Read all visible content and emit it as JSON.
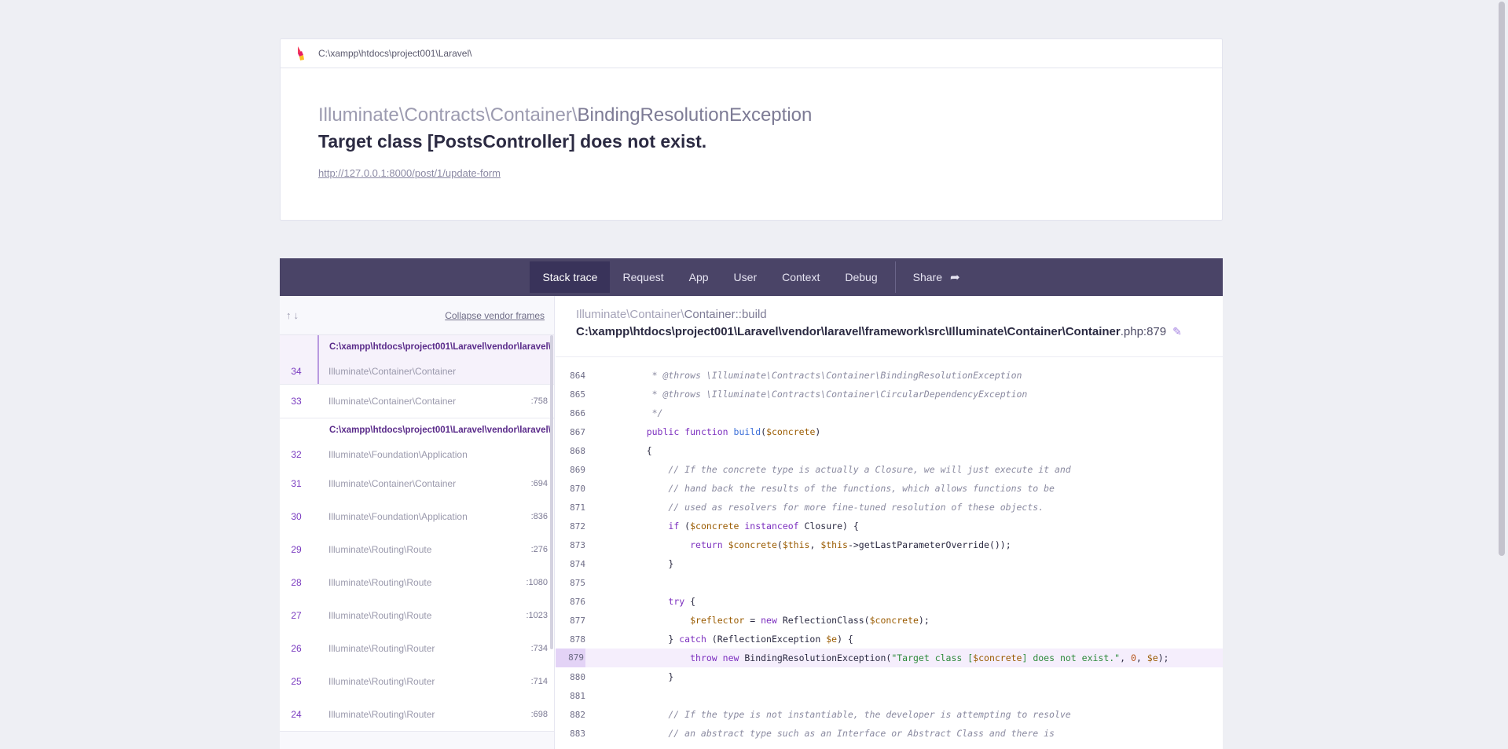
{
  "header": {
    "path": "C:\\xampp\\htdocs\\project001\\Laravel\\",
    "exception_namespace": "Illuminate\\Contracts\\Container\\",
    "exception_short": "BindingResolutionException",
    "message": "Target class [PostsController] does not exist.",
    "url": "http://127.0.0.1:8000/post/1/update-form"
  },
  "tabs": {
    "stack_trace": "Stack trace",
    "request": "Request",
    "app": "App",
    "user": "User",
    "context": "Context",
    "debug": "Debug",
    "share": "Share"
  },
  "frames": {
    "collapse_label": "Collapse vendor frames",
    "group1_file": "C:\\xampp\\htdocs\\project001\\Laravel\\vendor\\laravel\\",
    "group2_file": "C:\\xampp\\htdocs\\project001\\Laravel\\vendor\\laravel\\",
    "rows": [
      {
        "num": "34",
        "cls": "Illuminate\\Container\\Container",
        "line": ""
      },
      {
        "num": "33",
        "cls": "Illuminate\\Container\\Container",
        "line": ":758"
      },
      {
        "num": "32",
        "cls": "Illuminate\\Foundation\\Application",
        "line": ""
      },
      {
        "num": "31",
        "cls": "Illuminate\\Container\\Container",
        "line": ":694"
      },
      {
        "num": "30",
        "cls": "Illuminate\\Foundation\\Application",
        "line": ":836"
      },
      {
        "num": "29",
        "cls": "Illuminate\\Routing\\Route",
        "line": ":276"
      },
      {
        "num": "28",
        "cls": "Illuminate\\Routing\\Route",
        "line": ":1080"
      },
      {
        "num": "27",
        "cls": "Illuminate\\Routing\\Route",
        "line": ":1023"
      },
      {
        "num": "26",
        "cls": "Illuminate\\Routing\\Router",
        "line": ":734"
      },
      {
        "num": "25",
        "cls": "Illuminate\\Routing\\Router",
        "line": ":714"
      },
      {
        "num": "24",
        "cls": "Illuminate\\Routing\\Router",
        "line": ":698"
      }
    ]
  },
  "code": {
    "class_ns": "Illuminate\\Container\\",
    "class_method": "Container::build",
    "file": "C:\\xampp\\htdocs\\project001\\Laravel\\vendor\\laravel\\framework\\src\\Illuminate\\Container\\Container",
    "file_ext": ".php:879",
    "highlight_line": "879",
    "lines": [
      {
        "n": "864",
        "t": "     * @throws \\Illuminate\\Contracts\\Container\\BindingResolutionException"
      },
      {
        "n": "865",
        "t": "     * @throws \\Illuminate\\Contracts\\Container\\CircularDependencyException"
      },
      {
        "n": "866",
        "t": "     */"
      },
      {
        "n": "867",
        "t": "    public function build($concrete)"
      },
      {
        "n": "868",
        "t": "    {"
      },
      {
        "n": "869",
        "t": "        // If the concrete type is actually a Closure, we will just execute it and"
      },
      {
        "n": "870",
        "t": "        // hand back the results of the functions, which allows functions to be"
      },
      {
        "n": "871",
        "t": "        // used as resolvers for more fine-tuned resolution of these objects."
      },
      {
        "n": "872",
        "t": "        if ($concrete instanceof Closure) {"
      },
      {
        "n": "873",
        "t": "            return $concrete($this, $this->getLastParameterOverride());"
      },
      {
        "n": "874",
        "t": "        }"
      },
      {
        "n": "875",
        "t": ""
      },
      {
        "n": "876",
        "t": "        try {"
      },
      {
        "n": "877",
        "t": "            $reflector = new ReflectionClass($concrete);"
      },
      {
        "n": "878",
        "t": "        } catch (ReflectionException $e) {"
      },
      {
        "n": "879",
        "t": "            throw new BindingResolutionException(\"Target class [$concrete] does not exist.\", 0, $e);"
      },
      {
        "n": "880",
        "t": "        }"
      },
      {
        "n": "881",
        "t": ""
      },
      {
        "n": "882",
        "t": "        // If the type is not instantiable, the developer is attempting to resolve"
      },
      {
        "n": "883",
        "t": "        // an abstract type such as an Interface or Abstract Class and there is"
      }
    ]
  }
}
